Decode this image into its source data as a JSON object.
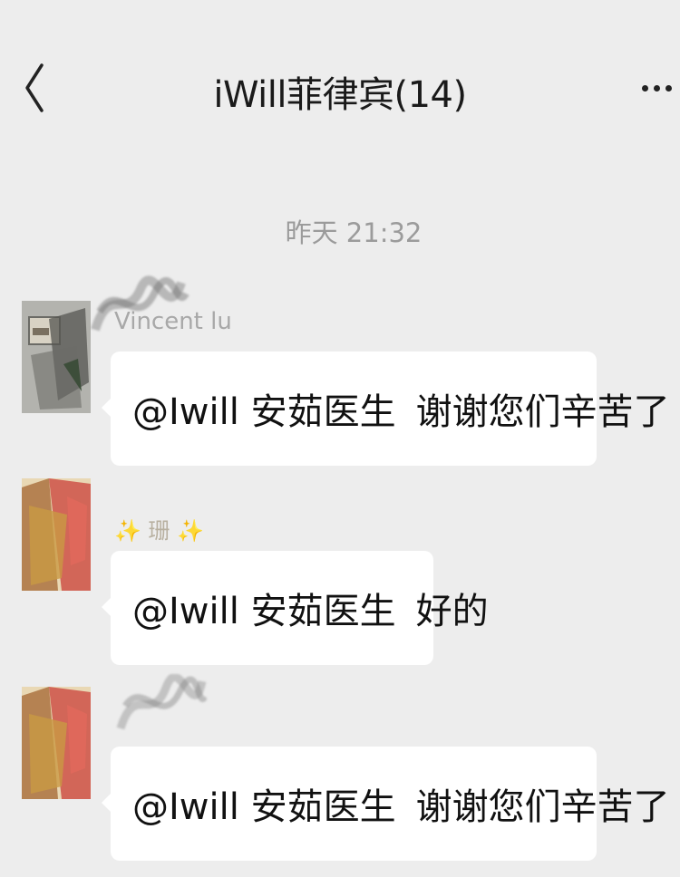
{
  "header": {
    "title": "iWill菲律宾(14)",
    "back_icon": "chevron-left-icon",
    "more_icon": "more-dots-icon"
  },
  "chat": {
    "timestamp": "昨天 21:32",
    "messages": [
      {
        "sender": "Vincent lu",
        "mention": "@Iwill 安茹医生",
        "text": "谢谢您们辛苦了"
      },
      {
        "sender": "✨ 珊 ✨",
        "mention": "@Iwill 安茹医生",
        "text": "好的"
      },
      {
        "sender": "",
        "mention": "@Iwill 安茹医生",
        "text": "谢谢您们辛苦了"
      }
    ]
  },
  "colors": {
    "background": "#ededed",
    "bubble": "#ffffff",
    "timestamp_text": "#9b9b9b",
    "sender_text": "#a8a8a8"
  }
}
